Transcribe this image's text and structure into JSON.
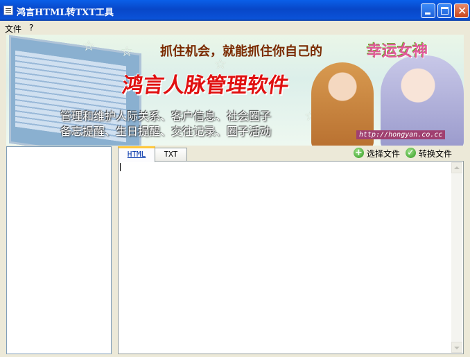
{
  "window": {
    "title": "鸿言HTML转TXT工具"
  },
  "menu": {
    "items": [
      "文件",
      "?"
    ]
  },
  "banner": {
    "slogan": "抓住机会，就能抓住你自己的",
    "goddess": "幸运女神",
    "product": "鸿言人脉管理软件",
    "desc_line1": "管理和维护人际关系、客户信息、社会圈子",
    "desc_line2": "备忘提醒、生日提醒、交往记录、圈子活动",
    "url": "http://hongyan.co.cc"
  },
  "tabs": [
    {
      "label": "HTML",
      "active": true
    },
    {
      "label": "TXT",
      "active": false
    }
  ],
  "actions": {
    "select_file": {
      "label": "选择文件",
      "icon": "add-icon"
    },
    "convert_file": {
      "label": "转换文件",
      "icon": "check-icon"
    }
  },
  "editor": {
    "value": ""
  },
  "colors": {
    "titlebar": "#0A5FE8",
    "tab_accent": "#FFC83C",
    "icon_green": "#2E9A1E",
    "product_red": "#E01010"
  }
}
